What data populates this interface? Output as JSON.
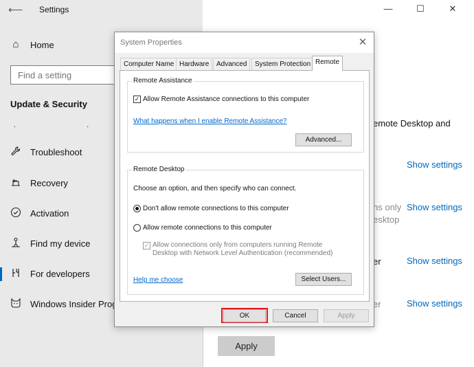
{
  "settings": {
    "title": "Settings",
    "back_icon": "back-arrow-icon",
    "home_label": "Home",
    "search_placeholder": "Find a setting",
    "section_heading": "Update & Security",
    "section_dots": ". .",
    "nav_items": [
      {
        "label": "Troubleshoot",
        "icon": "wrench-icon"
      },
      {
        "label": "Recovery",
        "icon": "recovery-icon"
      },
      {
        "label": "Activation",
        "icon": "check-circle-icon"
      },
      {
        "label": "Find my device",
        "icon": "person-locate-icon"
      },
      {
        "label": "For developers",
        "icon": "developer-icon"
      },
      {
        "label": "Windows Insider Prog",
        "icon": "insider-cat-icon"
      }
    ],
    "active_item": "For developers",
    "window_controls": {
      "minimize": "—",
      "maximize": "☐",
      "close": "✕"
    },
    "right_texts": {
      "remote_desktop_partial": "emote Desktop and",
      "show_settings_1": "Show settings",
      "partial_2a": "ns only",
      "partial_2b": "esktop",
      "show_settings_2": "Show settings",
      "partial_3": "er",
      "show_settings_3": "Show settings",
      "partial_4": "er",
      "show_settings_4": "Show settings"
    },
    "apply_label": "Apply",
    "accent_color": "#0067c0"
  },
  "dialog": {
    "title": "System Properties",
    "close_icon": "close-icon",
    "tabs": [
      "Computer Name",
      "Hardware",
      "Advanced",
      "System Protection",
      "Remote"
    ],
    "active_tab": "Remote",
    "remote_assistance": {
      "group_title": "Remote Assistance",
      "allow_label": "Allow Remote Assistance connections to this computer",
      "allow_checked": true,
      "help_link": "What happens when I enable Remote Assistance?",
      "advanced_button": "Advanced..."
    },
    "remote_desktop": {
      "group_title": "Remote Desktop",
      "instruction": "Choose an option, and then specify who can connect.",
      "option_deny": "Don't allow remote connections to this computer",
      "option_allow": "Allow remote connections to this computer",
      "selected_option": "deny",
      "nla_label": "Allow connections only from computers running Remote Desktop with Network Level Authentication (recommended)",
      "nla_checked": true,
      "help_link": "Help me choose",
      "select_users_button": "Select Users..."
    },
    "buttons": {
      "ok": "OK",
      "cancel": "Cancel",
      "apply": "Apply"
    },
    "highlight_color": "#e0161b"
  }
}
